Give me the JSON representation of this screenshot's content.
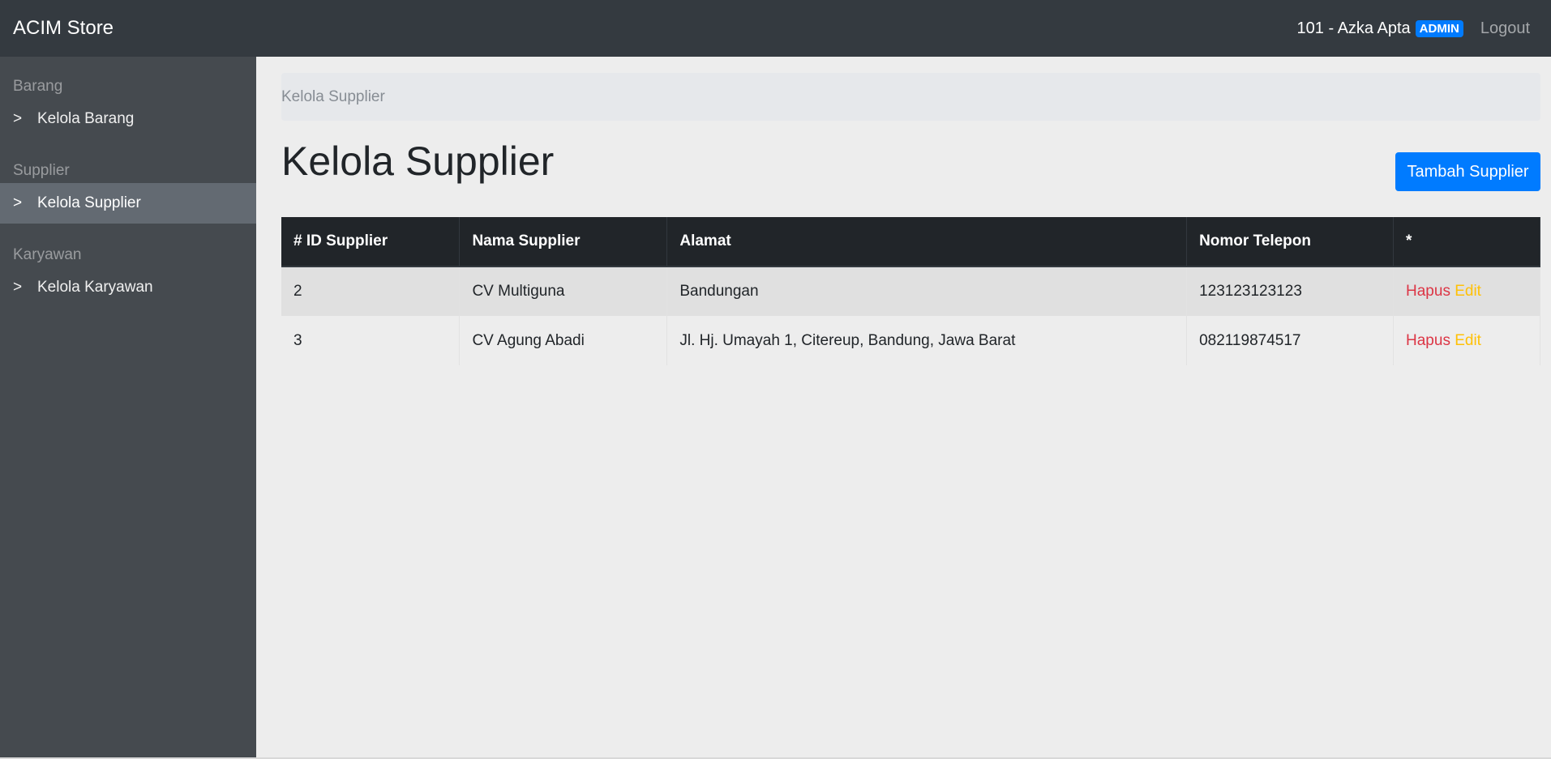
{
  "header": {
    "brand": "ACIM Store",
    "user": "101 - Azka Apta",
    "role_badge": "ADMIN",
    "logout": "Logout"
  },
  "sidebar": {
    "sections": [
      {
        "heading": "Barang",
        "items": [
          {
            "label": "Kelola Barang",
            "active": false
          }
        ]
      },
      {
        "heading": "Supplier",
        "items": [
          {
            "label": "Kelola Supplier",
            "active": true
          }
        ]
      },
      {
        "heading": "Karyawan",
        "items": [
          {
            "label": "Kelola Karyawan",
            "active": false
          }
        ]
      }
    ],
    "chevron": ">"
  },
  "main": {
    "breadcrumb": "Kelola Supplier",
    "title": "Kelola Supplier",
    "add_button": "Tambah Supplier",
    "table": {
      "columns": [
        "# ID Supplier",
        "Nama Supplier",
        "Alamat",
        "Nomor Telepon",
        "*"
      ],
      "rows": [
        {
          "id": "2",
          "nama": "CV Multiguna",
          "alamat": "Bandungan",
          "telepon": "123123123123",
          "hapus": "Hapus",
          "edit": "Edit"
        },
        {
          "id": "3",
          "nama": "CV Agung Abadi",
          "alamat": "Jl. Hj. Umayah 1, Citereup, Bandung, Jawa Barat",
          "telepon": "082119874517",
          "hapus": "Hapus",
          "edit": "Edit"
        }
      ]
    }
  },
  "colors": {
    "navbar": "#343a40",
    "sidebar": "#454a4f",
    "sidebar_active": "#636a72",
    "primary": "#007bff",
    "danger": "#dc3545",
    "warning": "#ffc107"
  }
}
